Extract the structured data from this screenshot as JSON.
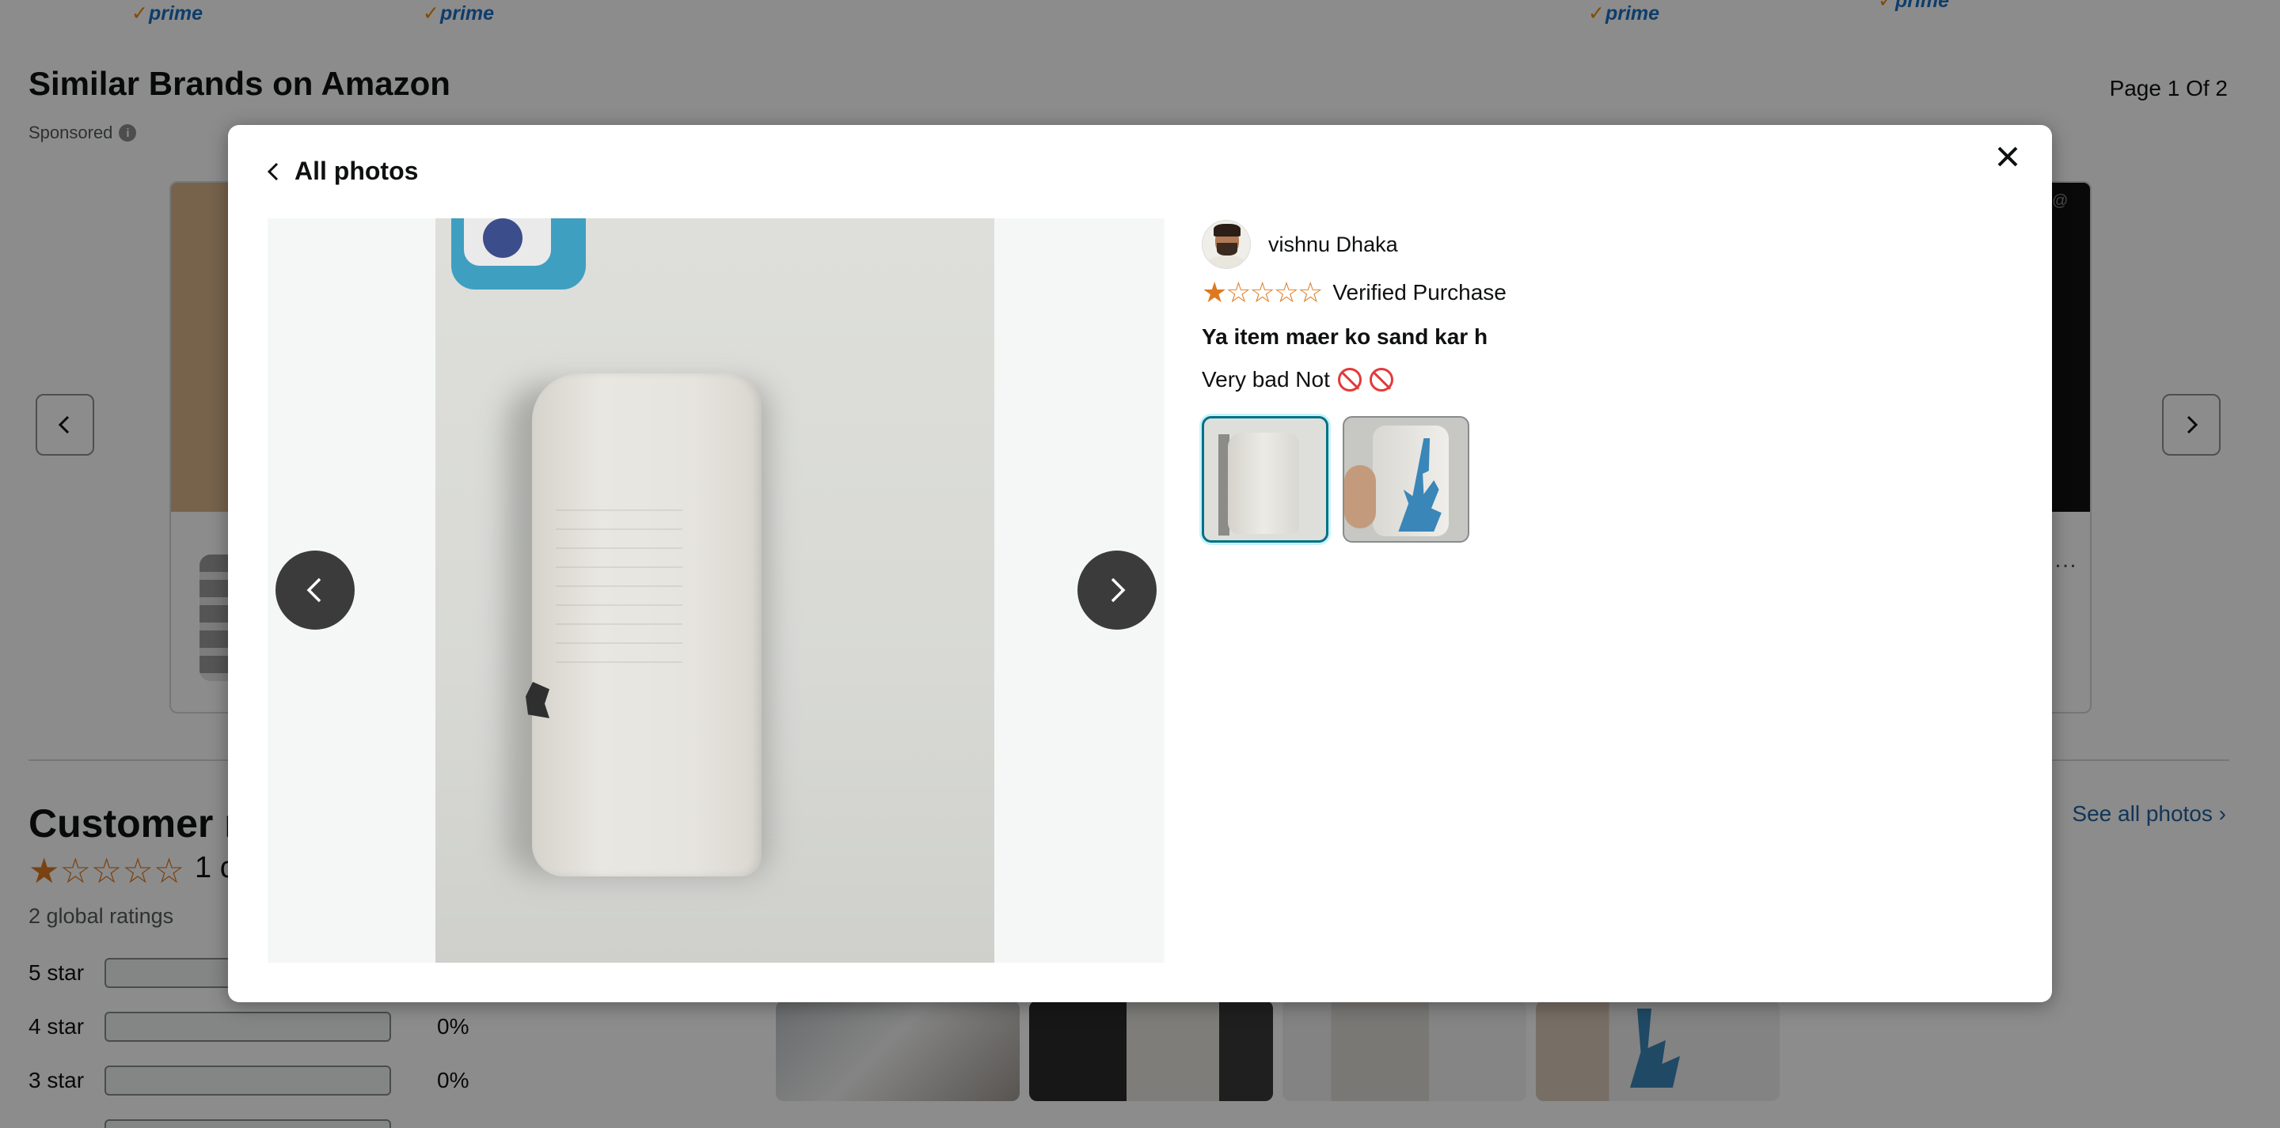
{
  "background": {
    "prime_badges": [
      "prime",
      "prime",
      "prime",
      "prime"
    ],
    "similar_brands_title": "Similar Brands on Amazon",
    "sponsored_label": "Sponsored",
    "page_indicator": "Page 1 Of 2",
    "reviews_title": "Customer re",
    "overall_rating_stars": 1,
    "overall_rating_text": "1 c",
    "global_ratings": "2 global ratings",
    "see_all_photos": "See all photos",
    "star_rows": [
      {
        "label": "5 star",
        "percent": ""
      },
      {
        "label": "4 star",
        "percent": "0%"
      },
      {
        "label": "3 star",
        "percent": "0%"
      }
    ]
  },
  "modal": {
    "back_label": "All photos",
    "reviewer_name": "vishnu Dhaka",
    "rating_stars": 1,
    "rating_max": 5,
    "verified_label": "Verified Purchase",
    "review_title": "Ya item maer ko sand kar h",
    "review_body": "Very bad Not",
    "selected_thumbnail": 0,
    "thumbnail_count": 2
  },
  "icons": {
    "close": "close-icon",
    "back": "chevron-left-icon",
    "prev": "chevron-left-icon",
    "next": "chevron-right-icon",
    "info": "info-icon",
    "emoji_1": "prohibited-emoji-icon",
    "emoji_2": "no-smoking-emoji-icon"
  },
  "colors": {
    "star": "#de7921",
    "link": "#2162a1",
    "selected_border": "#007185",
    "prime": "#1a6fc4"
  }
}
